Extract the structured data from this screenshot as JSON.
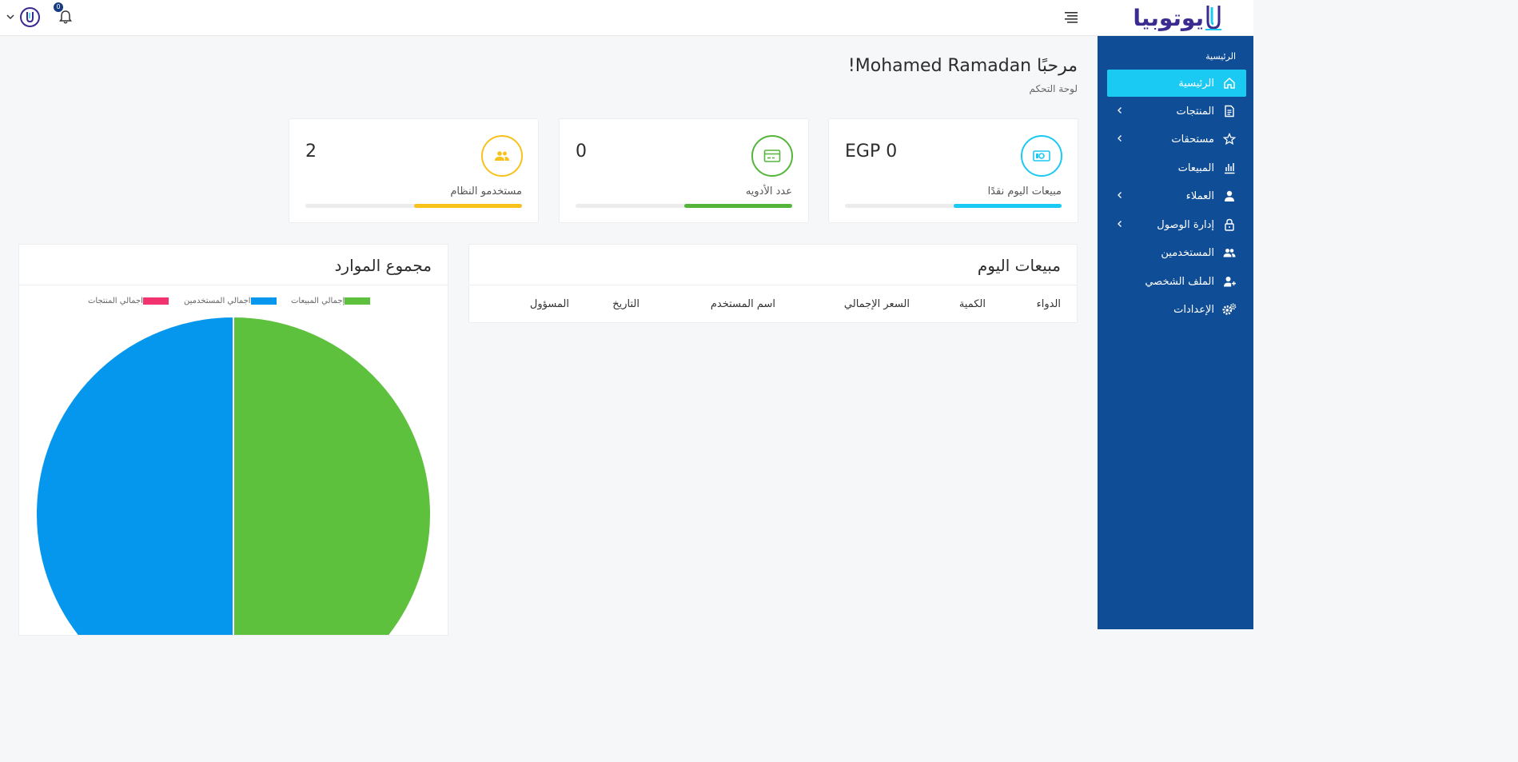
{
  "app": {
    "logo_text": "يوتوبيا"
  },
  "header": {
    "notifications_count": "0"
  },
  "sidebar": {
    "heading": "الرئيسية",
    "items": [
      {
        "label": "الرئيسية",
        "icon": "home-icon",
        "active": true,
        "has_caret": false
      },
      {
        "label": "المنتجات",
        "icon": "document-icon",
        "active": false,
        "has_caret": true
      },
      {
        "label": "مستحقات",
        "icon": "star-icon",
        "active": false,
        "has_caret": true
      },
      {
        "label": "المبيعات",
        "icon": "bar-chart-icon",
        "active": false,
        "has_caret": false
      },
      {
        "label": "العملاء",
        "icon": "user-icon",
        "active": false,
        "has_caret": true
      },
      {
        "label": "إدارة الوصول",
        "icon": "lock-icon",
        "active": false,
        "has_caret": true
      },
      {
        "label": "المستخدمين",
        "icon": "users-icon",
        "active": false,
        "has_caret": false
      },
      {
        "label": "الملف الشخصي",
        "icon": "user-plus-icon",
        "active": false,
        "has_caret": false
      },
      {
        "label": "الإعدادات",
        "icon": "gears-icon",
        "active": false,
        "has_caret": false
      }
    ]
  },
  "page": {
    "welcome": "مرحبًا Mohamed Ramadan!",
    "breadcrumb": "لوحة التحكم"
  },
  "stats": [
    {
      "value": "EGP 0",
      "label": "مبيعات اليوم نقدًا",
      "color": "#1bcaf2",
      "icon": "cash-icon",
      "progress": 0.5
    },
    {
      "value": "0",
      "label": "عدد الأدويه",
      "color": "#55b53a",
      "icon": "card-icon",
      "progress": 0.5
    },
    {
      "value": "2",
      "label": "مستخدمو النظام",
      "color": "#f7c21c",
      "icon": "users-icon",
      "progress": 0.5
    }
  ],
  "sales_table": {
    "title": "مبيعات اليوم",
    "columns": [
      "الدواء",
      "الكمية",
      "السعر الإجمالي",
      "اسم المستخدم",
      "التاريخ",
      "المسؤول"
    ],
    "rows": []
  },
  "resources_chart": {
    "title": "مجموع الموارد"
  },
  "chart_data": {
    "type": "pie",
    "series": [
      {
        "name": "إجمالي المبيعات",
        "value": 1,
        "color": "#5dc13e"
      },
      {
        "name": "اجمالي المستخدمين",
        "value": 1,
        "color": "#0596ed"
      },
      {
        "name": "اجمالي المنتجات",
        "value": 0,
        "color": "#f2336f"
      }
    ],
    "legend": "top"
  }
}
